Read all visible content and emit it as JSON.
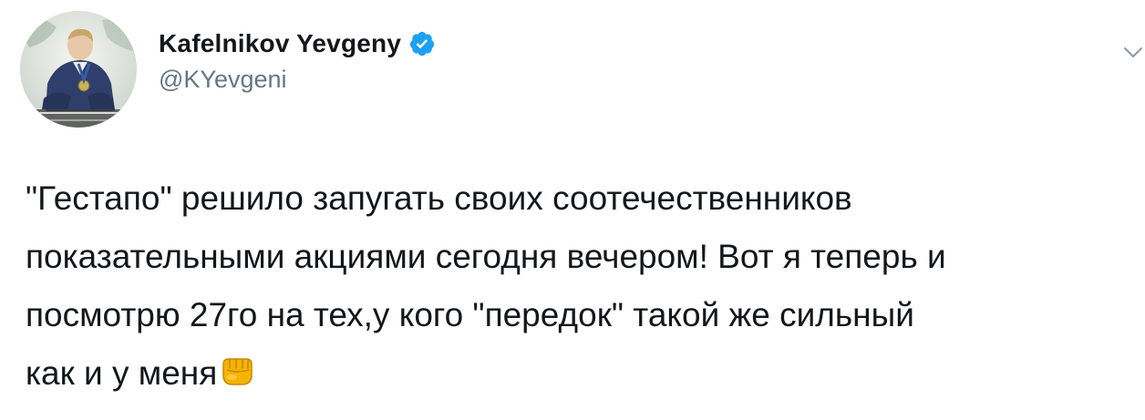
{
  "author": {
    "display_name": "Kafelnikov Yevgeny",
    "handle": "@KYevgeni",
    "verified": true,
    "avatar_icon": "user-avatar-photo"
  },
  "tweet": {
    "lines": [
      "\"Гестапо\" решило запугать своих соотечественников",
      "показательными акциями сегодня вечером! Вот я теперь и",
      "посмотрю 27го на тех,у кого \"передок\" такой же сильный",
      "как и у меня"
    ],
    "emoji": "fist-emoji"
  },
  "colors": {
    "text": "#14171a",
    "secondary_text": "#657786",
    "verified_blue": "#1da1f2"
  },
  "icons": {
    "verified": "verified-badge-icon",
    "caret": "chevron-down-icon"
  }
}
